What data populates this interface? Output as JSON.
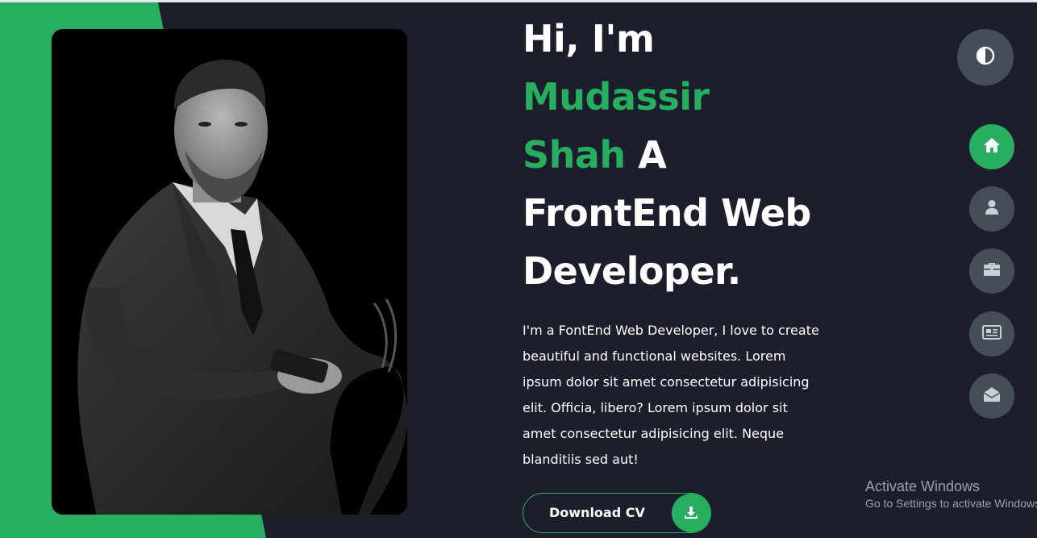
{
  "hero": {
    "greeting": "Hi, I'm",
    "name_first": "Mudassir",
    "name_last": "Shah",
    "role_prefix": "A",
    "role_line1": "FrontEnd Web",
    "role_line2": "Developer.",
    "description": "I'm a FontEnd Web Developer, I love to create beautiful and functional websites. Lorem ipsum dolor sit amet consectetur adipisicing elit. Officia, libero? Lorem ipsum dolor sit amet consectetur adipisicing elit. Neque blanditiis sed aut!",
    "cv_button_label": "Download CV",
    "cv_button_icon": "download-icon"
  },
  "controls": {
    "theme_toggle_icon": "contrast-icon"
  },
  "nav": {
    "items": [
      {
        "icon": "home-icon",
        "active": true
      },
      {
        "icon": "user-icon",
        "active": false
      },
      {
        "icon": "briefcase-icon",
        "active": false
      },
      {
        "icon": "newspaper-icon",
        "active": false
      },
      {
        "icon": "envelope-open-icon",
        "active": false
      }
    ]
  },
  "os_watermark": {
    "title": "Activate Windows",
    "subtitle": "Go to Settings to activate Windows."
  },
  "colors": {
    "accent": "#27ae60",
    "background": "#1c1f2b",
    "nav_button": "#454e56",
    "text": "#ffffff"
  }
}
